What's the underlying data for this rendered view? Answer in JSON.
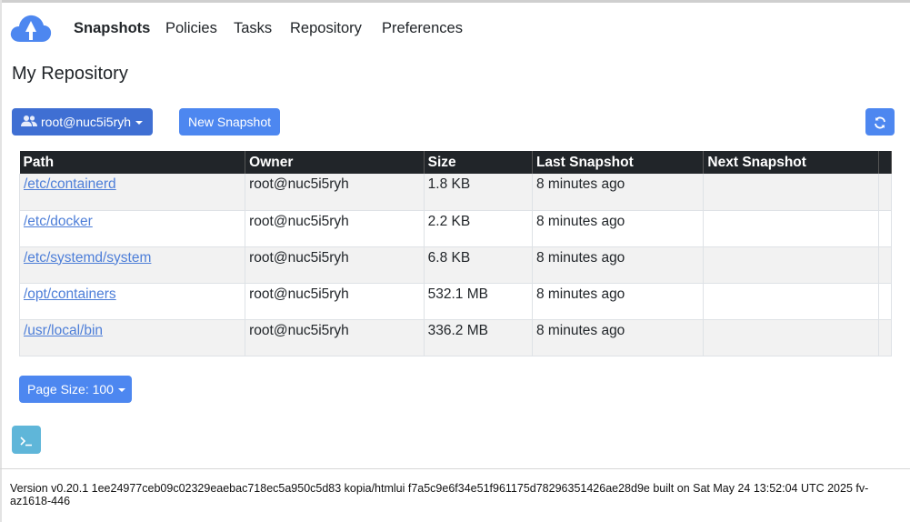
{
  "nav": {
    "items": [
      {
        "label": "Snapshots",
        "active": true
      },
      {
        "label": "Policies"
      },
      {
        "label": "Tasks"
      },
      {
        "label": "Repository"
      },
      {
        "label": "Preferences"
      }
    ]
  },
  "page": {
    "title": "My Repository"
  },
  "toolbar": {
    "user_label": "root@nuc5i5ryh",
    "new_snapshot_label": "New Snapshot"
  },
  "table": {
    "headers": [
      "Path",
      "Owner",
      "Size",
      "Last Snapshot",
      "Next Snapshot"
    ],
    "rows": [
      {
        "path": "/etc/containerd",
        "owner": "root@nuc5i5ryh",
        "size": "1.8 KB",
        "last": "8 minutes ago",
        "next": ""
      },
      {
        "path": "/etc/docker",
        "owner": "root@nuc5i5ryh",
        "size": "2.2 KB",
        "last": "8 minutes ago",
        "next": ""
      },
      {
        "path": "/etc/systemd/system",
        "owner": "root@nuc5i5ryh",
        "size": "6.8 KB",
        "last": "8 minutes ago",
        "next": ""
      },
      {
        "path": "/opt/containers",
        "owner": "root@nuc5i5ryh",
        "size": "532.1 MB",
        "last": "8 minutes ago",
        "next": ""
      },
      {
        "path": "/usr/local/bin",
        "owner": "root@nuc5i5ryh",
        "size": "336.2 MB",
        "last": "8 minutes ago",
        "next": ""
      }
    ]
  },
  "pagination": {
    "page_size_label": "Page Size: 100"
  },
  "footer": {
    "version_text": "Version v0.20.1 1ee24977ceb09c02329eaebac718ec5a950c5d83 kopia/htmlui f7a5c9e6f34e51f961175d78296351426ae28d9e built on Sat May 24 13:52:04 UTC 2025 fv-az1618-446"
  },
  "colors": {
    "primary": "#4d87f0",
    "user_button": "#3f6fd3",
    "info": "#5fb6d9",
    "table_header": "#212529",
    "link": "#4d7ed8"
  },
  "icons": {
    "logo": "cloud-logo-icon",
    "user": "users-icon",
    "refresh": "refresh-icon",
    "terminal": "terminal-icon"
  }
}
